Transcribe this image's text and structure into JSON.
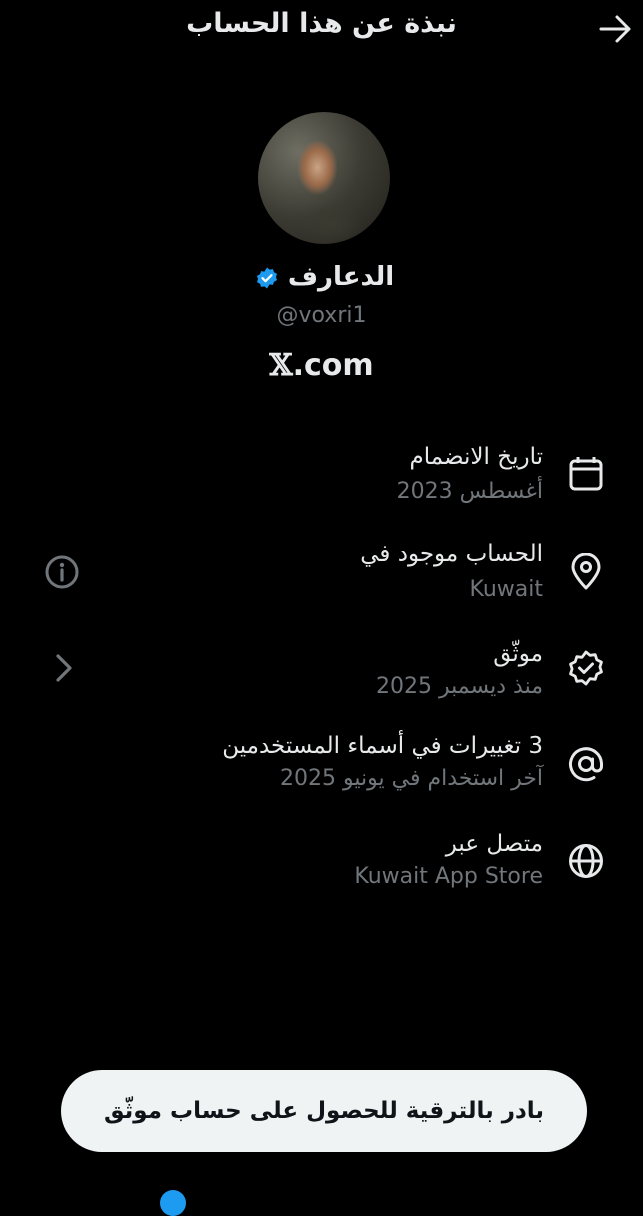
{
  "header": {
    "title": "نبذة عن هذا الحساب",
    "back_icon": "arrow-right-icon"
  },
  "profile": {
    "name": "الدعارف",
    "handle": "@voxri1",
    "verified_color": "#1d9bf0",
    "brand": ".com",
    "brand_icon": "x-logo"
  },
  "rows": [
    {
      "title": "تاريخ الانضمام",
      "subtitle": "أغسطس 2023",
      "icon": "calendar-icon"
    },
    {
      "title": "الحساب موجود في",
      "subtitle": "Kuwait",
      "icon": "location-pin-icon",
      "side_icon": "info-icon"
    },
    {
      "title": "موثّق",
      "subtitle": "منذ ديسمبر 2025",
      "icon": "verified-badge-icon",
      "side_icon": "chevron-right-icon"
    },
    {
      "title": "3 تغييرات في أسماء المستخدمين",
      "subtitle": "آخر استخدام في يونيو 2025",
      "icon": "at-sign-icon"
    },
    {
      "title": "متصل عبر",
      "subtitle": "Kuwait App Store",
      "icon": "globe-icon"
    }
  ],
  "cta": {
    "label": "بادر بالترقية للحصول على حساب موثّق"
  },
  "colors": {
    "background": "#000000",
    "text": "#e7e9ea",
    "secondary": "#71767b",
    "accent": "#1d9bf0",
    "button_bg": "#eff3f4"
  }
}
